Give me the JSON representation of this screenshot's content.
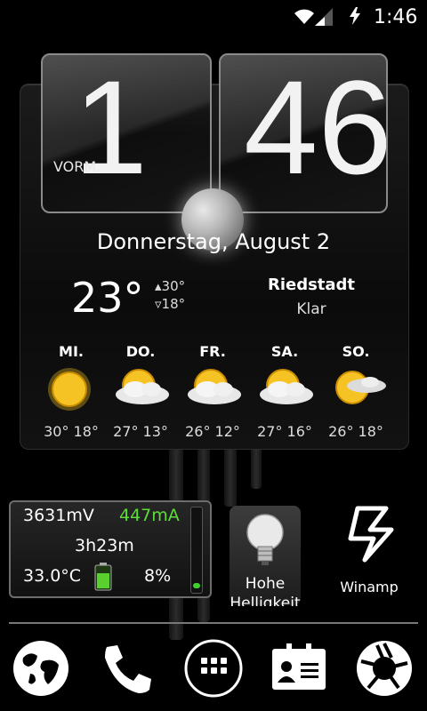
{
  "status_bar": {
    "time": "1:46"
  },
  "clock": {
    "hour": "1",
    "minute": "46",
    "ampm": "VORM."
  },
  "date": "Donnerstag, August 2",
  "weather": {
    "current_temp": "23°",
    "high": "▴30°",
    "low": "▿18°",
    "city": "Riedstadt",
    "condition": "Klar",
    "forecast": [
      {
        "day": "MI.",
        "temps": "30° 18°",
        "icon": "sun-icon"
      },
      {
        "day": "DO.",
        "temps": "27° 13°",
        "icon": "partly-cloudy-icon"
      },
      {
        "day": "FR.",
        "temps": "26° 12°",
        "icon": "partly-cloudy-icon"
      },
      {
        "day": "SA.",
        "temps": "27° 16°",
        "icon": "partly-cloudy-icon"
      },
      {
        "day": "SO.",
        "temps": "26° 18°",
        "icon": "partly-cloudy-icon"
      }
    ]
  },
  "battery": {
    "voltage": "3631mV",
    "current": "447mA",
    "remaining": "3h23m",
    "temperature": "33.0°C",
    "percent": "8%"
  },
  "shortcuts": {
    "brightness_label": "Hohe Helligkeit",
    "winamp_label": "Winamp"
  },
  "dock": [
    "browser-icon",
    "phone-icon",
    "app-drawer-icon",
    "contacts-icon",
    "camera-icon"
  ],
  "colors": {
    "accent_green": "#5edd3a",
    "background": "#000000"
  }
}
